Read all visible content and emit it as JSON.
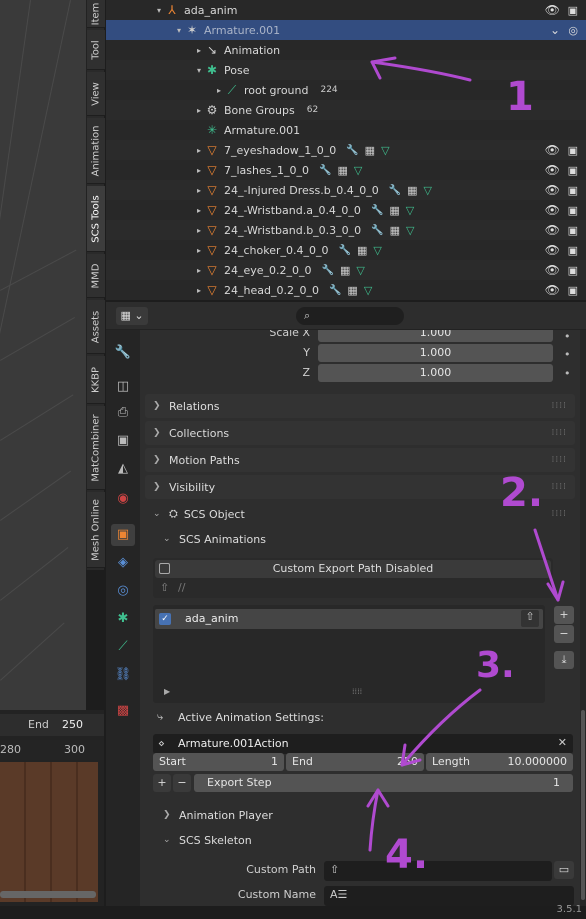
{
  "sidebar_tabs": [
    "Item",
    "Tool",
    "View",
    "Animation",
    "SCS Tools",
    "MMD",
    "Assets",
    "KKBP",
    "MatCombiner",
    "Mesh Online"
  ],
  "outliner": {
    "rows": [
      {
        "label": "ada_anim",
        "icon": "armature-data-icon",
        "tri": "▾",
        "indent": 0
      },
      {
        "label": "Armature.001",
        "icon": "armature-object-icon",
        "tri": "▾",
        "indent": 1,
        "selected": true
      },
      {
        "label": "Animation",
        "icon": "animation-icon",
        "tri": "▸",
        "indent": 2,
        "badge": ""
      },
      {
        "label": "Pose",
        "icon": "pose-icon",
        "tri": "▾",
        "indent": 2
      },
      {
        "label": "root ground",
        "icon": "bone-icon",
        "tri": "▸",
        "indent": 3,
        "badge": "224"
      },
      {
        "label": "Bone Groups",
        "icon": "bone-groups-icon",
        "tri": "▸",
        "indent": 2,
        "badge": "62"
      },
      {
        "label": "Armature.001",
        "icon": "armature-icon",
        "tri": "",
        "indent": 2
      },
      {
        "label": "7_eyeshadow_1_0_0",
        "icon": "mesh-icon",
        "tri": "▸",
        "indent": 2
      },
      {
        "label": "7_lashes_1_0_0",
        "icon": "mesh-icon",
        "tri": "▸",
        "indent": 2
      },
      {
        "label": "24_-Injured Dress.b_0.4_0_0",
        "icon": "mesh-icon",
        "tri": "▸",
        "indent": 2
      },
      {
        "label": "24_-Wristband.a_0.4_0_0",
        "icon": "mesh-icon",
        "tri": "▸",
        "indent": 2
      },
      {
        "label": "24_-Wristband.b_0.3_0_0",
        "icon": "mesh-icon",
        "tri": "▸",
        "indent": 2
      },
      {
        "label": "24_choker_0.4_0_0",
        "icon": "mesh-icon",
        "tri": "▸",
        "indent": 2
      },
      {
        "label": "24_eye_0.2_0_0",
        "icon": "mesh-icon",
        "tri": "▸",
        "indent": 2
      },
      {
        "label": "24_head_0.2_0_0",
        "icon": "mesh-icon",
        "tri": "▸",
        "indent": 2
      }
    ]
  },
  "transform": {
    "scale_x_label": "Scale X",
    "scale_x": "1.000",
    "y_label": "Y",
    "y": "1.000",
    "z_label": "Z",
    "z": "1.000"
  },
  "panels": {
    "relations": "Relations",
    "collections": "Collections",
    "motion_paths": "Motion Paths",
    "visibility": "Visibility",
    "scs_object": "SCS Object",
    "scs_animations": "SCS Animations",
    "animation_player": "Animation Player",
    "scs_skeleton": "SCS Skeleton"
  },
  "scs_animations": {
    "custom_export_path": "Custom Export Path Disabled",
    "path_placeholder": "//",
    "list_item": "ada_anim",
    "active_settings_label": "Active Animation Settings:",
    "action_name": "Armature.001Action",
    "start_label": "Start",
    "start_value": "1",
    "end_label": "End",
    "end_value": "250",
    "length_label": "Length",
    "length_value": "10.000000",
    "export_step_label": "Export Step",
    "export_step_value": "1"
  },
  "scs_skeleton": {
    "custom_path_label": "Custom Path",
    "custom_name_label": "Custom Name"
  },
  "timeline": {
    "end_label": "End",
    "end_value": "250",
    "tick1": "280",
    "tick2": "300"
  },
  "version": "3.5.1",
  "annotations": {
    "n1": "1",
    "n2": "2.",
    "n3": "3.",
    "n4": "4."
  }
}
